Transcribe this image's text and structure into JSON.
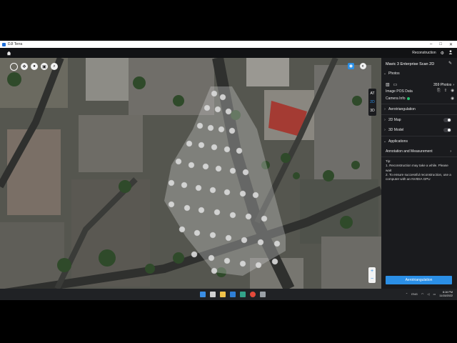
{
  "window": {
    "title": "DJI Terra"
  },
  "appbar": {
    "mode": "Reconstruction"
  },
  "map": {
    "tools": [
      "circle-select-icon",
      "pan-icon",
      "pin-icon",
      "camera-pos-icon",
      "search-icon"
    ],
    "view_modes": [
      "AT",
      "2D",
      "3D"
    ],
    "active_view": "2D",
    "zoom_in": "+",
    "zoom_out": "−"
  },
  "panel": {
    "title": "Mavic 3 Enterprise Scan 2D",
    "photos_section": "Photos",
    "photo_count": "359 Photos",
    "image_pos": "Image POS Data",
    "camera_info": "Camera Info",
    "aerotriangulation": "Aerotriangulation",
    "map_2d": "2D Map",
    "model_3d": "3D Model",
    "applications": "Applications",
    "annotation": "Annotation and Measurement",
    "tip_title": "Tip:",
    "tip_1": "1. Reconstruction may take a while. Please wait",
    "tip_2": "2. To ensure successful reconstruction, use a computer with an NVIDIA GPU",
    "action_button": "Aerotriangulation"
  },
  "taskbar": {
    "lang": "ENG",
    "time": "8:16 PM",
    "date": "11/15/2022"
  },
  "colors": {
    "accent": "#2b8fe6",
    "ok": "#25c26e",
    "panel_bg": "#1a1b1e"
  }
}
